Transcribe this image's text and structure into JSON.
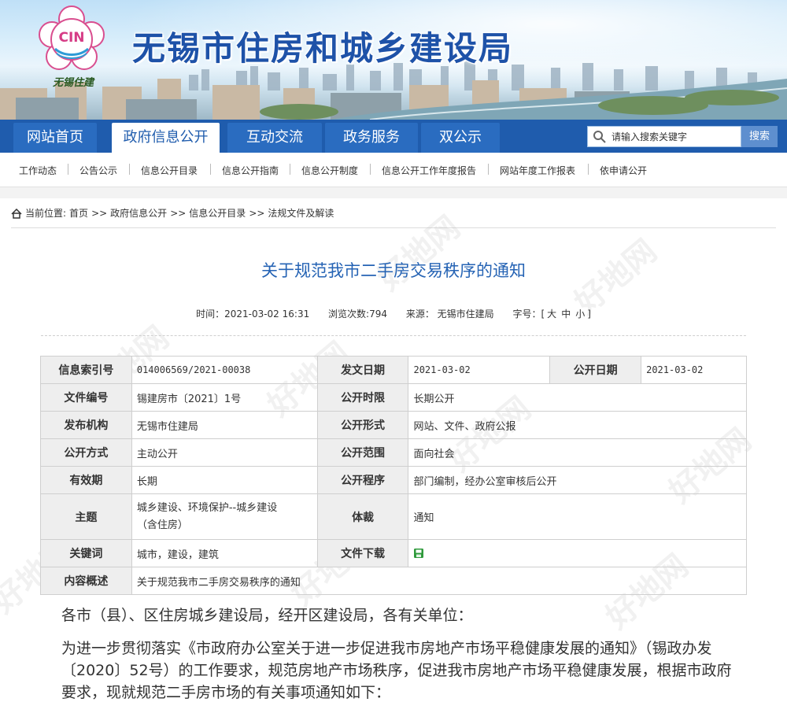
{
  "header": {
    "site_title": "无锡市住房和城乡建设局",
    "logo_text": "CIN",
    "logo_caption": "无锡住建"
  },
  "nav": {
    "items": [
      {
        "label": "网站首页",
        "active": false
      },
      {
        "label": "政府信息公开",
        "active": true
      },
      {
        "label": "互动交流",
        "active": false
      },
      {
        "label": "政务服务",
        "active": false
      },
      {
        "label": "双公示",
        "active": false
      }
    ],
    "search_placeholder": "请输入搜索关键字",
    "search_button": "搜索"
  },
  "subnav": {
    "items": [
      "工作动态",
      "公告公示",
      "信息公开目录",
      "信息公开指南",
      "信息公开制度",
      "信息公开工作年度报告",
      "网站年度工作报表",
      "依申请公开"
    ]
  },
  "breadcrumb": {
    "prefix": "当前位置:",
    "items": [
      "首页",
      "政府信息公开",
      "信息公开目录",
      "法规文件及解读"
    ],
    "separator": ">>"
  },
  "article": {
    "title": "关于规范我市二手房交易秩序的通知",
    "meta": {
      "time": "时间：2021-03-02 16:31",
      "views": "浏览次数:794",
      "source": "来源：  无锡市住建局",
      "size_label": "字号：[",
      "size_big": "大",
      "size_mid": "中",
      "size_small": "小",
      "size_end": "]"
    },
    "info_table": {
      "r1": {
        "k1": "信息索引号",
        "v1": "014006569/2021-00038",
        "k2": "发文日期",
        "v2": "2021-03-02",
        "k3": "公开日期",
        "v3": "2021-03-02"
      },
      "r2": {
        "k1": "文件编号",
        "v1": "锡建房市〔2021〕1号",
        "k2": "公开时限",
        "v2": "长期公开"
      },
      "r3": {
        "k1": "发布机构",
        "v1": "无锡市住建局",
        "k2": "公开形式",
        "v2": "网站、文件、政府公报"
      },
      "r4": {
        "k1": "公开方式",
        "v1": "主动公开",
        "k2": "公开范围",
        "v2": "面向社会"
      },
      "r5": {
        "k1": "有效期",
        "v1": "长期",
        "k2": "公开程序",
        "v2": "部门编制，经办公室审核后公开"
      },
      "r6": {
        "k1": "主题",
        "v1a": "城乡建设、环境保护--城乡建设",
        "v1b": "（含住房）",
        "k2": "体裁",
        "v2": "通知"
      },
      "r7": {
        "k1": "关键词",
        "v1": "城市，建设，建筑",
        "k2": "文件下载"
      },
      "r8": {
        "k1": "内容概述",
        "v1": "关于规范我市二手房交易秩序的通知"
      }
    },
    "paragraphs": [
      "各市（县）、区住房城乡建设局，经开区建设局，各有关单位：",
      "为进一步贯彻落实《市政府办公室关于进一步促进我市房地产市场平稳健康发展的通知》（锡政办发〔2020〕52号）的工作要求，规范房地产市场秩序，促进我市房地产市场平稳健康发展，根据市政府要求，现就规范二手房市场的有关事项通知如下："
    ]
  },
  "colors": {
    "nav_bg": "#1f5cad",
    "title_blue": "#2563b4",
    "table_key_bg": "#eeeeee"
  }
}
